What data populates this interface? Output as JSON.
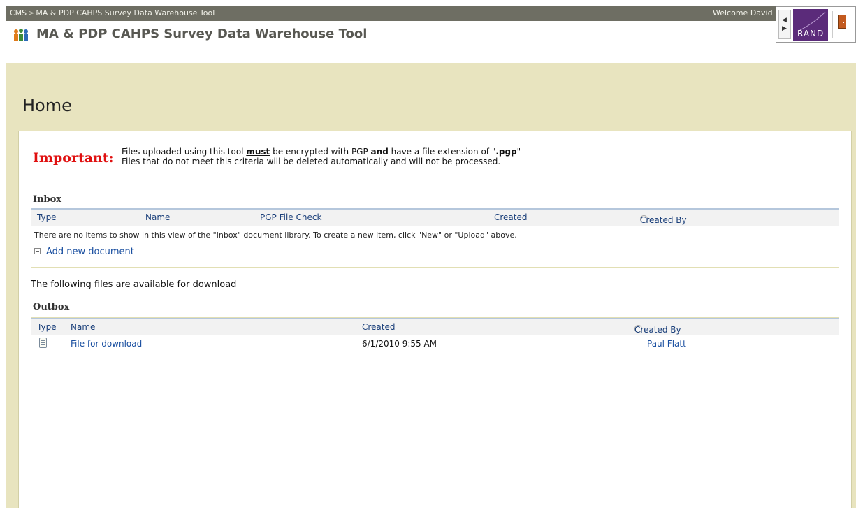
{
  "topbar": {
    "breadcrumb_root": "CMS",
    "breadcrumb_sep": ">",
    "breadcrumb_site": "MA & PDP CAHPS Survey Data Warehouse Tool",
    "welcome": "Welcome David"
  },
  "header": {
    "site_title": "MA & PDP CAHPS Survey Data Warehouse Tool",
    "logo_text": "RAND",
    "colors": {
      "logo_bg": "#5b2b7a",
      "exit_icon": "#c35a1f"
    }
  },
  "page": {
    "title": "Home"
  },
  "notice": {
    "label": "Important:",
    "line1_a": "Files uploaded using this tool",
    "line1_must": "must",
    "line1_b": "be encrypted with PGP",
    "line1_and": "and",
    "line1_c": "have a file extension of \"",
    "line1_ext": ".pgp",
    "line1_d": "\"",
    "line2": "Files that do not meet this criteria will be deleted automatically and will not be processed.",
    "color": "#e01010"
  },
  "inbox": {
    "title": "Inbox",
    "columns": [
      "Type",
      "Name",
      "PGP File Check",
      "Created",
      "Created By"
    ],
    "empty_message": "There are no items to show in this view of the \"Inbox\" document library. To create a new item, click \"New\" or \"Upload\" above.",
    "add_new": "Add new document"
  },
  "download_note": "The following files are available for download",
  "outbox": {
    "title": "Outbox",
    "columns": [
      "Type",
      "Name",
      "Created",
      "Created By"
    ],
    "rows": [
      {
        "type_icon": "document-icon",
        "name": "File for download",
        "created": "6/1/2010 9:55 AM",
        "created_by": "Paul Flatt"
      }
    ]
  }
}
